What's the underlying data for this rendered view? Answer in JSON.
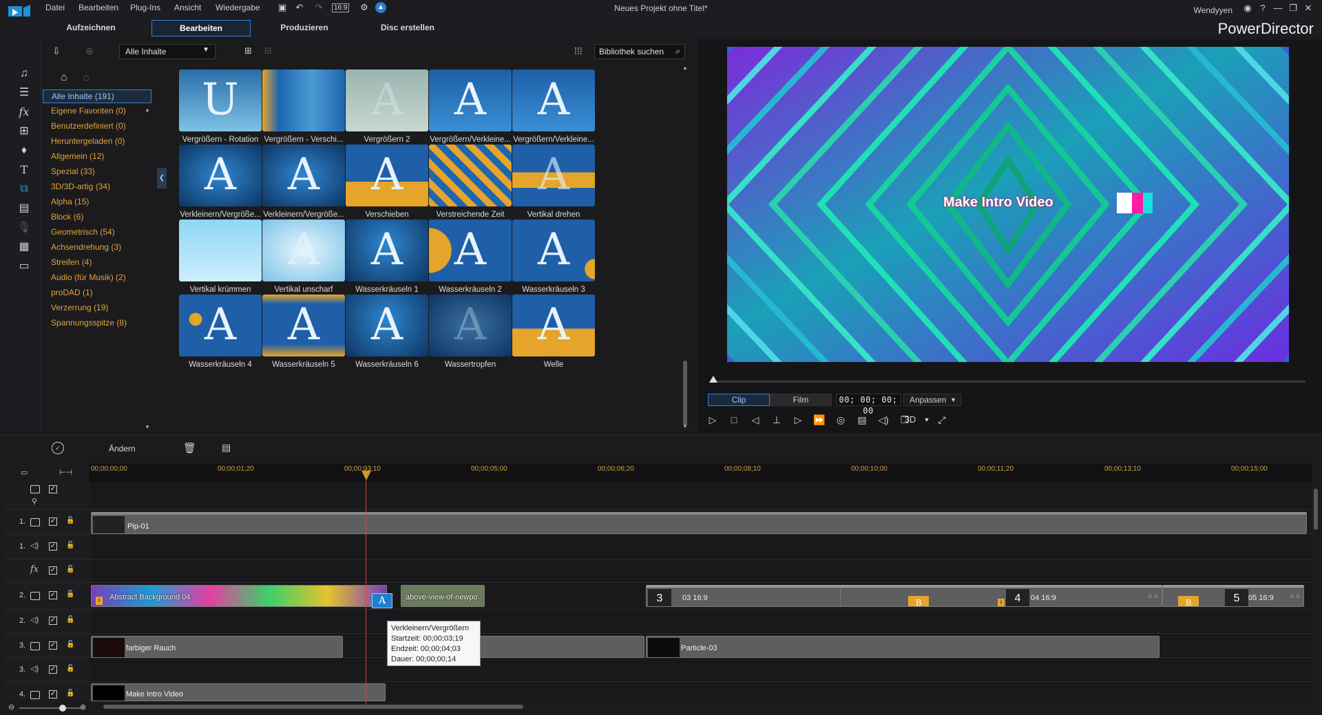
{
  "menu": [
    "Datei",
    "Bearbeiten",
    "Plug-Ins",
    "Ansicht",
    "Wiedergabe"
  ],
  "toolbar": {
    "aspect_ratio": "16:9"
  },
  "window": {
    "project_title": "Neues Projekt ohne Titel*",
    "user": "Wendyyen",
    "app_name": "PowerDirector"
  },
  "modes": [
    "Aufzeichnen",
    "Bearbeiten",
    "Produzieren",
    "Disc erstellen"
  ],
  "library": {
    "content_filter": "Alle Inhalte",
    "search_placeholder": "Bibliothek suchen",
    "categories": [
      "Alle Inhalte (191)",
      "Eigene Favoriten  (0)",
      "Benutzerdefiniert  (0)",
      "Heruntergeladen  (0)",
      "Allgemein  (12)",
      "Spezial  (33)",
      "3D/3D-artig  (34)",
      "Alpha  (15)",
      "Block  (6)",
      "Geometrisch  (54)",
      "Achsendrehung  (3)",
      "Streifen  (4)",
      "Audio (für Musik)  (2)",
      "proDAD  (1)",
      "Verzerrung  (19)",
      "Spannungsspitze  (8)"
    ],
    "items": [
      "Vergrößern - Rotation",
      "Vergrößern - Verschi...",
      "Vergrößern 2",
      "Vergrößern/Verkleine...",
      "Vergrößern/Verkleine...",
      "Verkleinern/Vergröße...",
      "Verkleinern/Vergröße...",
      "Verschieben",
      "Verstreichende Zeit",
      "Vertikal drehen",
      "Vertikal krümmen",
      "Vertikal unscharf",
      "Wasserkräuseln 1",
      "Wasserkräuseln 2",
      "Wasserkräuseln 3",
      "Wasserkräuseln 4",
      "Wasserkräuseln 5",
      "Wasserkräuseln 6",
      "Wassertropfen",
      "Welle"
    ]
  },
  "preview": {
    "overlay_text": "Make Intro Video",
    "clip_label": "Clip",
    "film_label": "Film",
    "timecode": "00; 00; 00; 00",
    "fit_label": "Anpassen",
    "mode_3d": "3D"
  },
  "timeline": {
    "edit_label": "Ändern",
    "ruler": [
      "00;00;00;00",
      "00;00;01;20",
      "00;00;03;10",
      "00;00;05;00",
      "00;00;06;20",
      "00;00;08;10",
      "00;00;10;00",
      "00;00;11;20",
      "00;00;13;10",
      "00;00;15;00"
    ],
    "track_numbers": [
      "1.",
      "1.",
      "2.",
      "2.",
      "3.",
      "3.",
      "4."
    ],
    "fx_label": "fx",
    "clips": {
      "pip": "Pip-01",
      "abstract": "Abstract Background 04",
      "aerial": "above-view-of-newpo",
      "t3": "03 16:9",
      "t4": "04 16:9",
      "t5": "05 16:9",
      "t3_num": "3",
      "t4_num": "4",
      "t5_num": "5",
      "smoke": "farbiger Rauch",
      "particle": "Particle-03",
      "intro": "Make Intro Video"
    },
    "tooltip": {
      "name": "Verkleinern/Vergrößern",
      "start": "Startzeit: 00;00;03;19",
      "end": "Endzeit: 00;00;04;03",
      "duration": "Dauer: 00;00;00;14"
    }
  },
  "colors": {
    "accent": "#2d82d6",
    "category_text": "#e3a33c",
    "playhead": "#ff3333",
    "ruler_text": "#cda14a"
  }
}
